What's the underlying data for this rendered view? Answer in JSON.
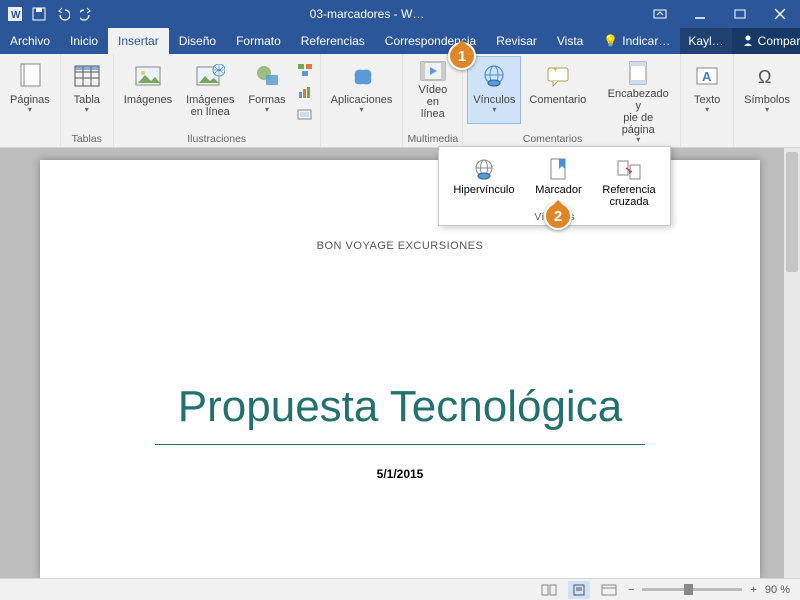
{
  "titlebar": {
    "doc_name": "03-marcadores  -  W…"
  },
  "menu": {
    "tabs": [
      "Archivo",
      "Inicio",
      "Insertar",
      "Diseño",
      "Formato",
      "Referencias",
      "Correspondencia",
      "Revisar",
      "Vista"
    ],
    "active_index": 2,
    "tell_me": "Indicar…",
    "user": "Kayl…",
    "share": "Compartir"
  },
  "ribbon": {
    "paginas": {
      "btn": "Páginas",
      "group": ""
    },
    "tablas": {
      "btn": "Tabla",
      "group": "Tablas"
    },
    "ilustraciones": {
      "imagenes": "Imágenes",
      "imagenes_linea": "Imágenes\nen línea",
      "formas": "Formas",
      "group": "Ilustraciones"
    },
    "aplicaciones": {
      "btn": "Aplicaciones"
    },
    "multimedia": {
      "video": "Vídeo\nen línea",
      "group": "Multimedia"
    },
    "vinculos": {
      "btn": "Vínculos"
    },
    "comentarios": {
      "btn": "Comentario",
      "group": "Comentarios"
    },
    "encabezado": {
      "btn": "Encabezado y\npie de página"
    },
    "texto": {
      "btn": "Texto"
    },
    "simbolos": {
      "btn": "Símbolos"
    }
  },
  "dropdown": {
    "hipervinculo": "Hipervínculo",
    "marcador": "Marcador",
    "referencia": "Referencia\ncruzada",
    "group": "Vínculos"
  },
  "document": {
    "header": "BON VOYAGE EXCURSIONES",
    "title": "Propuesta Tecnológica",
    "date": "5/1/2015"
  },
  "status": {
    "zoom": "90 %"
  },
  "callouts": {
    "c1": "1",
    "c2": "2"
  }
}
